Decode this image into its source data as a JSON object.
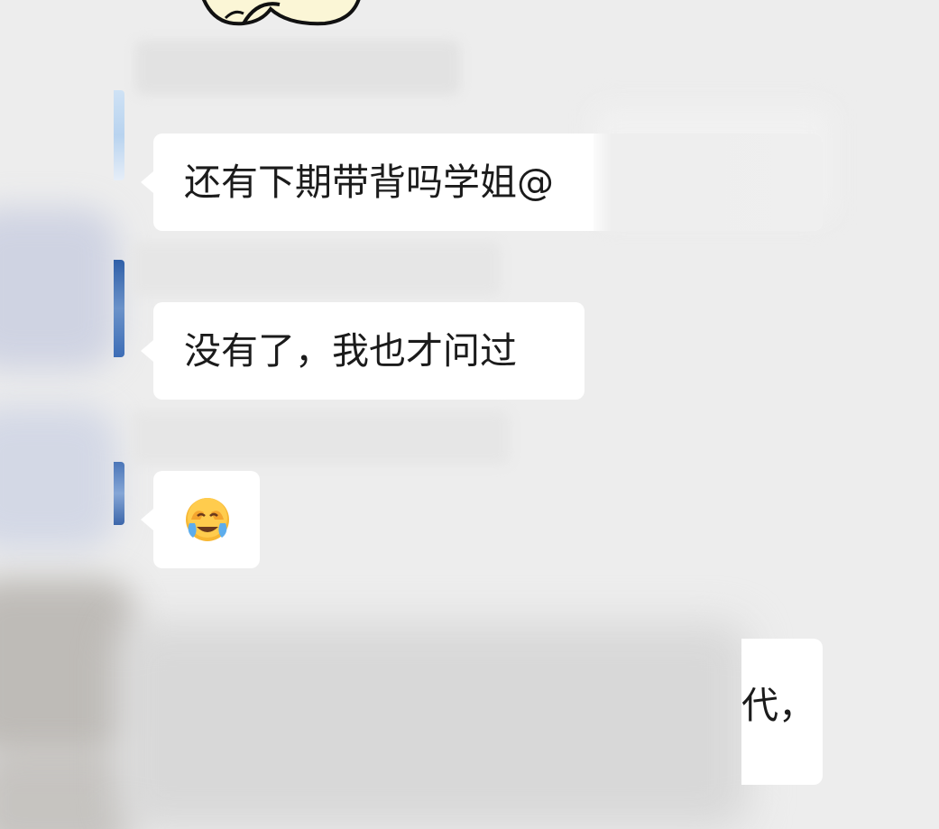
{
  "chat": {
    "messages": [
      {
        "sender": "other",
        "text": "还有下期带背吗学姐@"
      },
      {
        "sender": "other",
        "text": "没有了，我也才问过"
      },
      {
        "sender": "other",
        "emoji": "face-with-tears-of-joy-icon"
      },
      {
        "sender": "self",
        "text": "代，"
      }
    ]
  },
  "colors": {
    "background": "#ededed",
    "bubble": "#ffffff",
    "text": "#1b1b1b"
  }
}
